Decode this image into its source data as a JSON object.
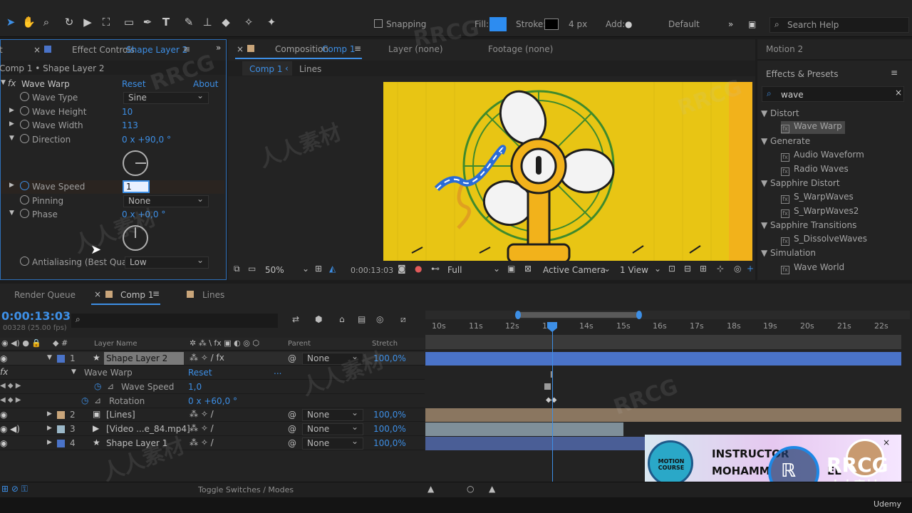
{
  "toolbar": {
    "snapping_label": "Snapping",
    "fill_label": "Fill:",
    "stroke_label": "Stroke:",
    "stroke_px": "4 px",
    "add_label": "Add:",
    "workspace": "Default",
    "search_placeholder": "Search Help"
  },
  "effect_controls": {
    "tab_title": "Effect Controls",
    "tab_layer": "Shape Layer 2",
    "breadcrumb": "Comp 1 • Shape Layer 2",
    "effect_name": "Wave Warp",
    "reset": "Reset",
    "about": "About",
    "props": {
      "wave_type": {
        "label": "Wave Type",
        "value": "Sine"
      },
      "wave_height": {
        "label": "Wave Height",
        "value": "10"
      },
      "wave_width": {
        "label": "Wave Width",
        "value": "113"
      },
      "direction": {
        "label": "Direction",
        "value": "0 x +90,0 °"
      },
      "wave_speed": {
        "label": "Wave Speed",
        "value": "1"
      },
      "pinning": {
        "label": "Pinning",
        "value": "None"
      },
      "phase": {
        "label": "Phase",
        "value": "0 x +0,0 °"
      },
      "antialiasing": {
        "label": "Antialiasing (Best Qualit",
        "value": "Low"
      }
    }
  },
  "composition": {
    "tab_title": "Composition",
    "tab_comp": "Comp 1",
    "layer_tab": "Layer (none)",
    "footage_tab": "Footage (none)",
    "breadcrumb_active": "Comp 1",
    "breadcrumb_next": "Lines",
    "zoom": "50%",
    "timecode": "0:00:13:03",
    "resolution": "Full",
    "camera": "Active Camera",
    "views": "1 View"
  },
  "right_panel": {
    "motion_tab": "Motion 2",
    "effects_title": "Effects & Presets",
    "search_value": "wave",
    "categories": [
      {
        "name": "Distort",
        "items": [
          "Wave Warp"
        ]
      },
      {
        "name": "Generate",
        "items": [
          "Audio Waveform",
          "Radio Waves"
        ]
      },
      {
        "name": "Sapphire Distort",
        "items": [
          "S_WarpWaves",
          "S_WarpWaves2"
        ]
      },
      {
        "name": "Sapphire Transitions",
        "items": [
          "S_DissolveWaves"
        ]
      },
      {
        "name": "Simulation",
        "items": [
          "Wave World"
        ]
      }
    ]
  },
  "timeline": {
    "render_queue_tab": "Render Queue",
    "comp_tab": "Comp 1",
    "lines_tab": "Lines",
    "timecode": "0:00:13:03",
    "frame_info": "00328 (25.00 fps)",
    "col_layer_name": "Layer Name",
    "col_parent": "Parent",
    "col_stretch": "Stretch",
    "ruler": [
      "10s",
      "11s",
      "12s",
      "13s",
      "14s",
      "15s",
      "16s",
      "17s",
      "18s",
      "19s",
      "20s",
      "21s",
      "22s"
    ],
    "layers": [
      {
        "num": "1",
        "name": "Shape Layer 2",
        "parent": "None",
        "stretch": "100,0%"
      },
      {
        "num": "2",
        "name": "[Lines]",
        "parent": "None",
        "stretch": "100,0%"
      },
      {
        "num": "3",
        "name": "[Video ...e_84.mp4]",
        "parent": "None",
        "stretch": "100,0%"
      },
      {
        "num": "4",
        "name": "Shape Layer 1",
        "parent": "None",
        "stretch": "100,0%"
      }
    ],
    "sub_effect": "Wave Warp",
    "sub_reset": "Reset",
    "sub_props": [
      {
        "label": "Wave Speed",
        "value": "1,0"
      },
      {
        "label": "Rotation",
        "value": "0 x +60,0 °"
      }
    ],
    "toggle_label": "Toggle Switches / Modes"
  },
  "banner": {
    "logo_text": "MOTION COURSE",
    "line1": "INSTRUCTOR",
    "line2": "MOHAMM",
    "line2_tail": "EL"
  },
  "watermarks": {
    "rrcg": "RRCG",
    "cn": "人人素材",
    "udemy": "Udemy"
  },
  "colors": {
    "accent": "#3d8fe6",
    "canvas_yellow": "#e8c514",
    "fan_orange": "#f2b21b",
    "fan_green": "#3f8a2c",
    "bar_blue": "#4a73c8"
  }
}
